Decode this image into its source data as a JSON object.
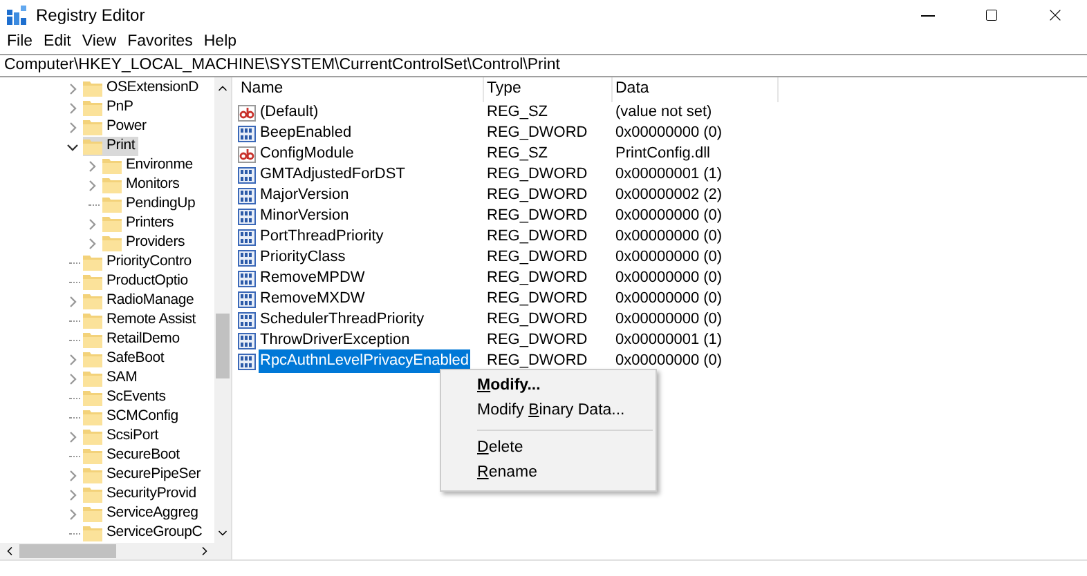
{
  "window": {
    "title": "Registry Editor"
  },
  "menu": [
    "File",
    "Edit",
    "View",
    "Favorites",
    "Help"
  ],
  "address": "Computer\\HKEY_LOCAL_MACHINE\\SYSTEM\\CurrentControlSet\\Control\\Print",
  "tree": [
    {
      "label": "OSExtensionD",
      "kind": "branch",
      "expanded": false,
      "selected": false
    },
    {
      "label": "PnP",
      "kind": "branch",
      "expanded": false,
      "selected": false
    },
    {
      "label": "Power",
      "kind": "branch",
      "expanded": false,
      "selected": false
    },
    {
      "label": "Print",
      "kind": "branch",
      "expanded": true,
      "selected": true,
      "children": [
        {
          "label": "Environme",
          "kind": "branch",
          "expanded": false,
          "selected": false
        },
        {
          "label": "Monitors",
          "kind": "branch",
          "expanded": false,
          "selected": false
        },
        {
          "label": "PendingUp",
          "kind": "leaf",
          "selected": false
        },
        {
          "label": "Printers",
          "kind": "branch",
          "expanded": false,
          "selected": false
        },
        {
          "label": "Providers",
          "kind": "branch",
          "expanded": false,
          "selected": false
        }
      ]
    },
    {
      "label": "PriorityContro",
      "kind": "leaf",
      "selected": false
    },
    {
      "label": "ProductOptio",
      "kind": "leaf",
      "selected": false
    },
    {
      "label": "RadioManage",
      "kind": "branch",
      "expanded": false,
      "selected": false
    },
    {
      "label": "Remote Assist",
      "kind": "leaf",
      "selected": false
    },
    {
      "label": "RetailDemo",
      "kind": "leaf",
      "selected": false
    },
    {
      "label": "SafeBoot",
      "kind": "branch",
      "expanded": false,
      "selected": false
    },
    {
      "label": "SAM",
      "kind": "branch",
      "expanded": false,
      "selected": false
    },
    {
      "label": "ScEvents",
      "kind": "leaf",
      "selected": false
    },
    {
      "label": "SCMConfig",
      "kind": "leaf",
      "selected": false
    },
    {
      "label": "ScsiPort",
      "kind": "branch",
      "expanded": false,
      "selected": false
    },
    {
      "label": "SecureBoot",
      "kind": "leaf",
      "selected": false
    },
    {
      "label": "SecurePipeSer",
      "kind": "branch",
      "expanded": false,
      "selected": false
    },
    {
      "label": "SecurityProvid",
      "kind": "branch",
      "expanded": false,
      "selected": false
    },
    {
      "label": "ServiceAggreg",
      "kind": "branch",
      "expanded": false,
      "selected": false
    },
    {
      "label": "ServiceGroupC",
      "kind": "leaf",
      "selected": false
    }
  ],
  "list": {
    "columns": [
      "Name",
      "Type",
      "Data"
    ],
    "rows": [
      {
        "kind": "string",
        "name": "(Default)",
        "type": "REG_SZ",
        "data": "(value not set)",
        "selected": false
      },
      {
        "kind": "binary",
        "name": "BeepEnabled",
        "type": "REG_DWORD",
        "data": "0x00000000 (0)",
        "selected": false
      },
      {
        "kind": "string",
        "name": "ConfigModule",
        "type": "REG_SZ",
        "data": "PrintConfig.dll",
        "selected": false
      },
      {
        "kind": "binary",
        "name": "GMTAdjustedForDST",
        "type": "REG_DWORD",
        "data": "0x00000001 (1)",
        "selected": false
      },
      {
        "kind": "binary",
        "name": "MajorVersion",
        "type": "REG_DWORD",
        "data": "0x00000002 (2)",
        "selected": false
      },
      {
        "kind": "binary",
        "name": "MinorVersion",
        "type": "REG_DWORD",
        "data": "0x00000000 (0)",
        "selected": false
      },
      {
        "kind": "binary",
        "name": "PortThreadPriority",
        "type": "REG_DWORD",
        "data": "0x00000000 (0)",
        "selected": false
      },
      {
        "kind": "binary",
        "name": "PriorityClass",
        "type": "REG_DWORD",
        "data": "0x00000000 (0)",
        "selected": false
      },
      {
        "kind": "binary",
        "name": "RemoveMPDW",
        "type": "REG_DWORD",
        "data": "0x00000000 (0)",
        "selected": false
      },
      {
        "kind": "binary",
        "name": "RemoveMXDW",
        "type": "REG_DWORD",
        "data": "0x00000000 (0)",
        "selected": false
      },
      {
        "kind": "binary",
        "name": "SchedulerThreadPriority",
        "type": "REG_DWORD",
        "data": "0x00000000 (0)",
        "selected": false
      },
      {
        "kind": "binary",
        "name": "ThrowDriverException",
        "type": "REG_DWORD",
        "data": "0x00000001 (1)",
        "selected": false
      },
      {
        "kind": "binary",
        "name": "RpcAuthnLevelPrivacyEnabled",
        "type": "REG_DWORD",
        "data": "0x00000000 (0)",
        "selected": true
      }
    ]
  },
  "context_menu": {
    "items": [
      {
        "kind": "item",
        "default": true,
        "key": "M",
        "rest": "odify..."
      },
      {
        "kind": "item",
        "default": false,
        "lead": "Modify ",
        "key": "B",
        "rest": "inary Data..."
      },
      {
        "kind": "separator"
      },
      {
        "kind": "item",
        "default": false,
        "key": "D",
        "rest": "elete"
      },
      {
        "kind": "item",
        "default": false,
        "key": "R",
        "rest": "ename"
      }
    ]
  }
}
